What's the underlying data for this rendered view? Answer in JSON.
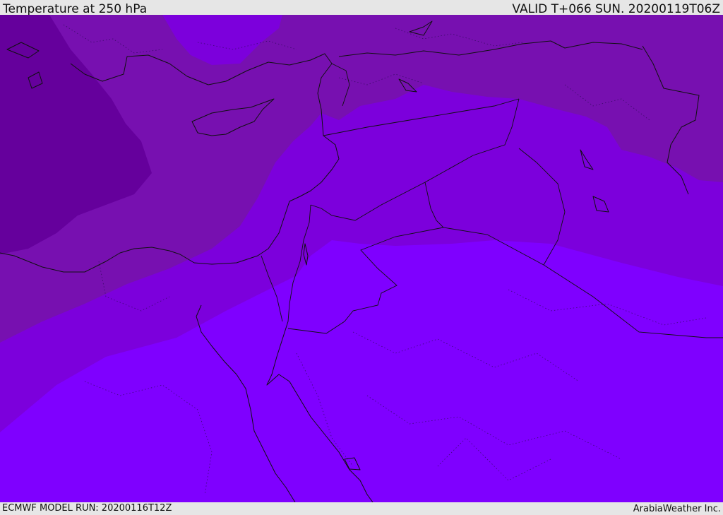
{
  "header": {
    "title": "Temperature at 250 hPa",
    "valid": "VALID T+066 SUN. 20200119T06Z"
  },
  "footer": {
    "model_run": "ECMWF MODEL RUN: 20200116T12Z",
    "credit": "ArabiaWeather Inc."
  },
  "colors": {
    "band_coldest": "#65009c",
    "band_cold": "#7710b0",
    "band_mid": "#7c00dc",
    "band_warm": "#8000f5",
    "band_warmest": "#7f00ff",
    "coastline": "#101010",
    "bar_background": "#e6e6e6"
  }
}
